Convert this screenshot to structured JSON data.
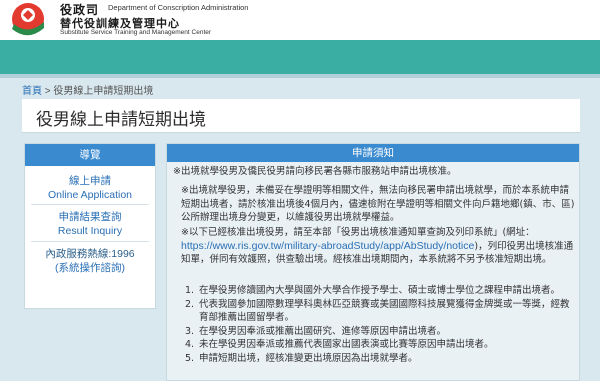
{
  "header": {
    "org_zh": "役政司",
    "org_en": "Department of Conscription Administration",
    "center_zh": "替代役訓練及管理中心",
    "center_en": "Substitute Service Training and Management Center"
  },
  "breadcrumb": {
    "home": "首頁",
    "separator": ">",
    "current": "役男線上申請短期出境"
  },
  "page_title": "役男線上申請短期出境",
  "sidebar": {
    "heading": "導覽",
    "apply_zh": "線上申請",
    "apply_en": "Online Application",
    "query_zh": "申請結果查詢",
    "query_en": "Result Inquiry",
    "hotline": "內政服務熱線:1996",
    "hotline_sub": "(系統操作諮詢)"
  },
  "notice": {
    "heading": "申請須知",
    "intro": "※出境就學役男及僑民役男請向移民署各縣市服務站申請出境核准。",
    "para_study": "※出境就學役男，未備妥在學證明等相關文件，無法向移民署申請出境就學，而於本系統申請短期出境者，請於核准出境後4個月內，儘速檢附在學證明等相關文件向戶籍地鄉(鎮、市、區)公所辦理出境身分變更，以維護役男出境就學權益。",
    "para_record_prefix": "※以下已經核准出境役男，請至本部「役男出境核准通知單查詢及列印系統」(網址：",
    "url": "https://www.ris.gov.tw/military-abroadStudy/app/AbStudy/notice",
    "para_record_suffix": ")，列印役男出境核准通知單，併同有效護照，供查驗出境。經核准出境期間內，本系統將不另予核准短期出境。",
    "items": [
      "在學役男修讀國內大學與國外大學合作授予學士、碩士或博士學位之課程申請出境者。",
      "代表我國參加國際數理學科奧林匹亞競賽或美國國際科技展覽獲得金牌獎或一等獎，經教育部推薦出國留學者。",
      "在學役男因奉派或推薦出國研究、進修等原因申請出境者。",
      "未在學役男因奉派或推薦代表國家出國表演或比賽等原因申請出境者。",
      "申請短期出境，經核准變更出境原因為出境就學者。"
    ]
  },
  "colors": {
    "teal": "#3aaea3",
    "blue": "#3a8ad0",
    "background": "#d9e8ef"
  }
}
